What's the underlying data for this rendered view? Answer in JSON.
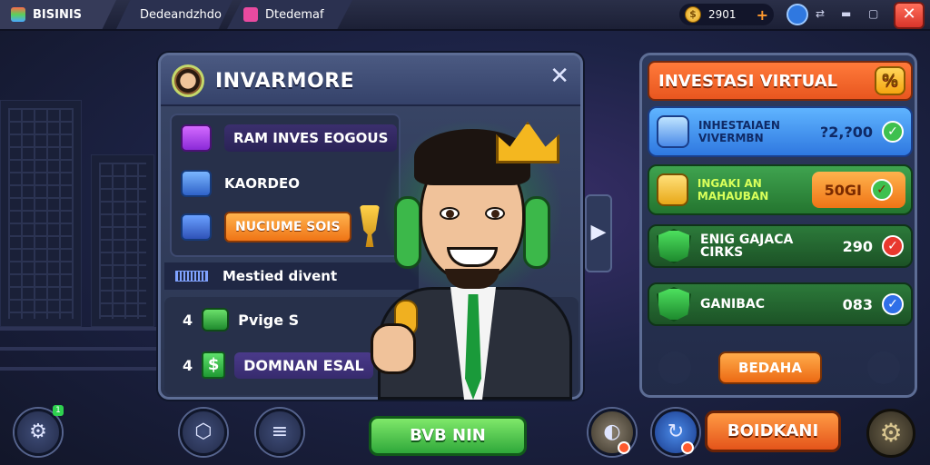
{
  "topbar": {
    "tabs": [
      {
        "label": "BISINIS",
        "color": "#5ad15a"
      },
      {
        "label": "Dedeandzhdo",
        "color": "#4aa8ff"
      },
      {
        "label": "Dtedemaf",
        "color": "#e84aa0"
      }
    ],
    "coins": "2901",
    "coin_glyph": "$",
    "plus": "+",
    "close": "✕"
  },
  "panel": {
    "title": "INVARMORE",
    "close": "✕",
    "rows": [
      {
        "label": "RAM INVES EOGOUS",
        "icon": "cube-icon"
      },
      {
        "label": "KAORDEO",
        "icon": "bank-icon"
      },
      {
        "button": "NUCIUME SOIS",
        "icon": "house-icon"
      }
    ],
    "subhead": "Mestied divent",
    "bottom_rows": [
      {
        "num": "4",
        "label": "Pvige S"
      },
      {
        "num": "4",
        "label": "DOMNAN ESAL",
        "dollar": "$"
      }
    ]
  },
  "right_panel": {
    "title": "INVESTASI VIRTUAL",
    "head_icon": "%",
    "cards": [
      {
        "text": "INHESTAIAEN VIVERMBN",
        "value": "?2,?00",
        "status": "✓"
      },
      {
        "text": "INGAKI AN MAHAUBAN",
        "value": "50GI",
        "status": "✓"
      },
      {
        "text": "ENIG GAJACA CIRKS",
        "value": "290",
        "status": "✓"
      },
      {
        "text": "GANIBAC",
        "value": "083",
        "status": "✓"
      }
    ],
    "button": "BEDAHA"
  },
  "bottom": {
    "green_button": "BVB NIN",
    "orange_button": "BOIDKANI",
    "notify_count": "1"
  },
  "colors": {
    "accent_orange": "#ef7416",
    "accent_green": "#2fa83a",
    "panel_border": "#5d6d95"
  }
}
